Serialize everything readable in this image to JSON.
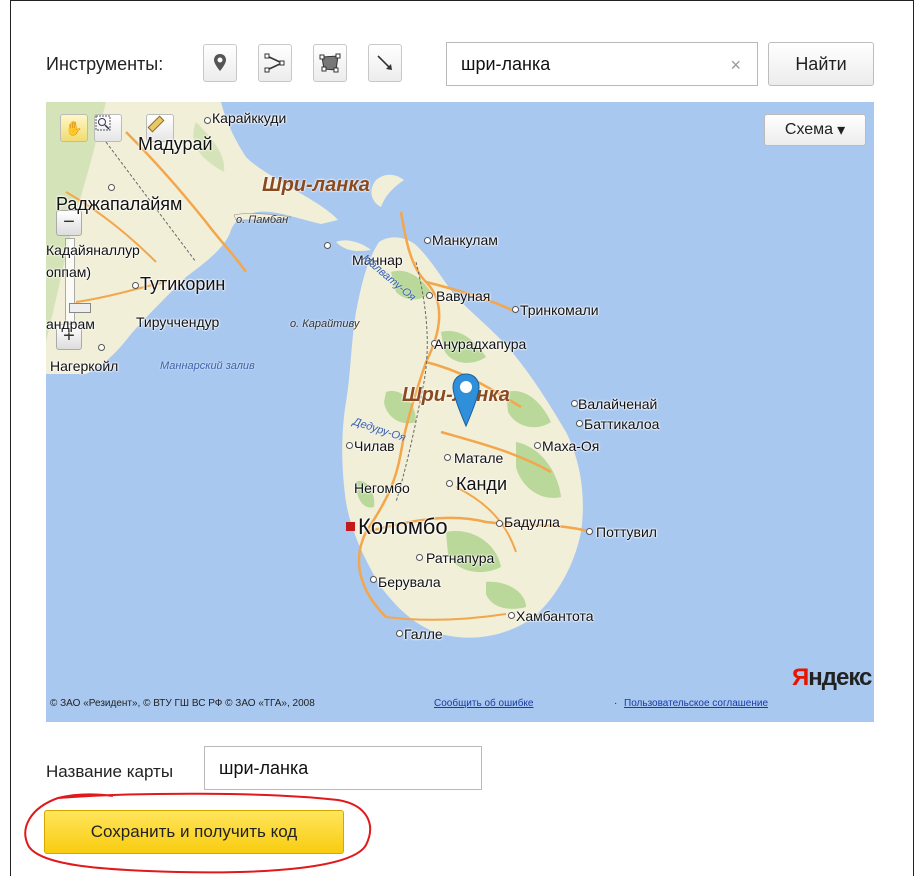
{
  "toolbar": {
    "label": "Инструменты:",
    "tools": [
      {
        "name": "placemark-tool",
        "icon": "pin-icon"
      },
      {
        "name": "polyline-tool",
        "icon": "polyline-icon"
      },
      {
        "name": "polygon-tool",
        "icon": "polygon-icon"
      },
      {
        "name": "ruler-tool",
        "icon": "diagonal-arrow-icon"
      }
    ],
    "search_value": "шри-ланка",
    "clear_icon": "×",
    "find_label": "Найти"
  },
  "map": {
    "scheme_label": "Схема",
    "scheme_arrow": "▾",
    "zoom_in": "+",
    "zoom_out": "−",
    "country_label": "Шри-ланка",
    "country_label_center": "Шри-ланка",
    "cities": {
      "karaikkudi": "Карайккуди",
      "madurai": "Мадурай",
      "rajapalayam": "Раджапалайям",
      "pamban": "о. Памбан",
      "kadayanallur": "Кадайяналлур",
      "oppam": "оппам)",
      "tuticorin": "Тутикорин",
      "tiruchendur": "Тируччендур",
      "andram": "андрам",
      "kalpitiya": "о. Карайтиву",
      "nagercoil": "Нагеркойл",
      "gulf": "Маннарский залив",
      "mankulam": "Манкулам",
      "mannar": "Маннар",
      "vavuniya": "Вавуная",
      "malvatu": "Малвату-Оя",
      "trincomalee": "Тринкомали",
      "anuradhapura": "Анурадхапура",
      "valaichchenai": "Валайченай",
      "batticaloa": "Баттикалоа",
      "deduru": "Дедуру-Оя",
      "chilaw": "Чилав",
      "matale": "Матале",
      "mahaoya": "Маха-Оя",
      "negombo": "Негомбо",
      "kandy": "Канди",
      "colombo": "Коломбо",
      "badulla": "Бадулла",
      "pottuvil": "Поттувил",
      "ratnapura": "Ратнапура",
      "beruwala": "Берувала",
      "hambantota": "Хамбантота",
      "galle": "Галле"
    },
    "copyright": "© ЗАО «Резидент», © ВТУ ГШ ВС РФ © ЗАО «ТГА», 2008",
    "report_error": "Сообщить об ошибке",
    "separator": "·",
    "user_agreement": "Пользовательское соглашение",
    "logo_y": "Я",
    "logo_rest": "ндекс"
  },
  "form": {
    "name_label": "Название карты",
    "name_value": "шри-ланка",
    "save_label": "Сохранить и получить код"
  },
  "colors": {
    "accent_button": "#f8cc10",
    "annotation": "#e0191b",
    "water": "#a9c8f0",
    "land": "#f2efd9",
    "forest": "#b9d89a",
    "roads": "#f3a64a",
    "marker": "#2f8fd8"
  }
}
